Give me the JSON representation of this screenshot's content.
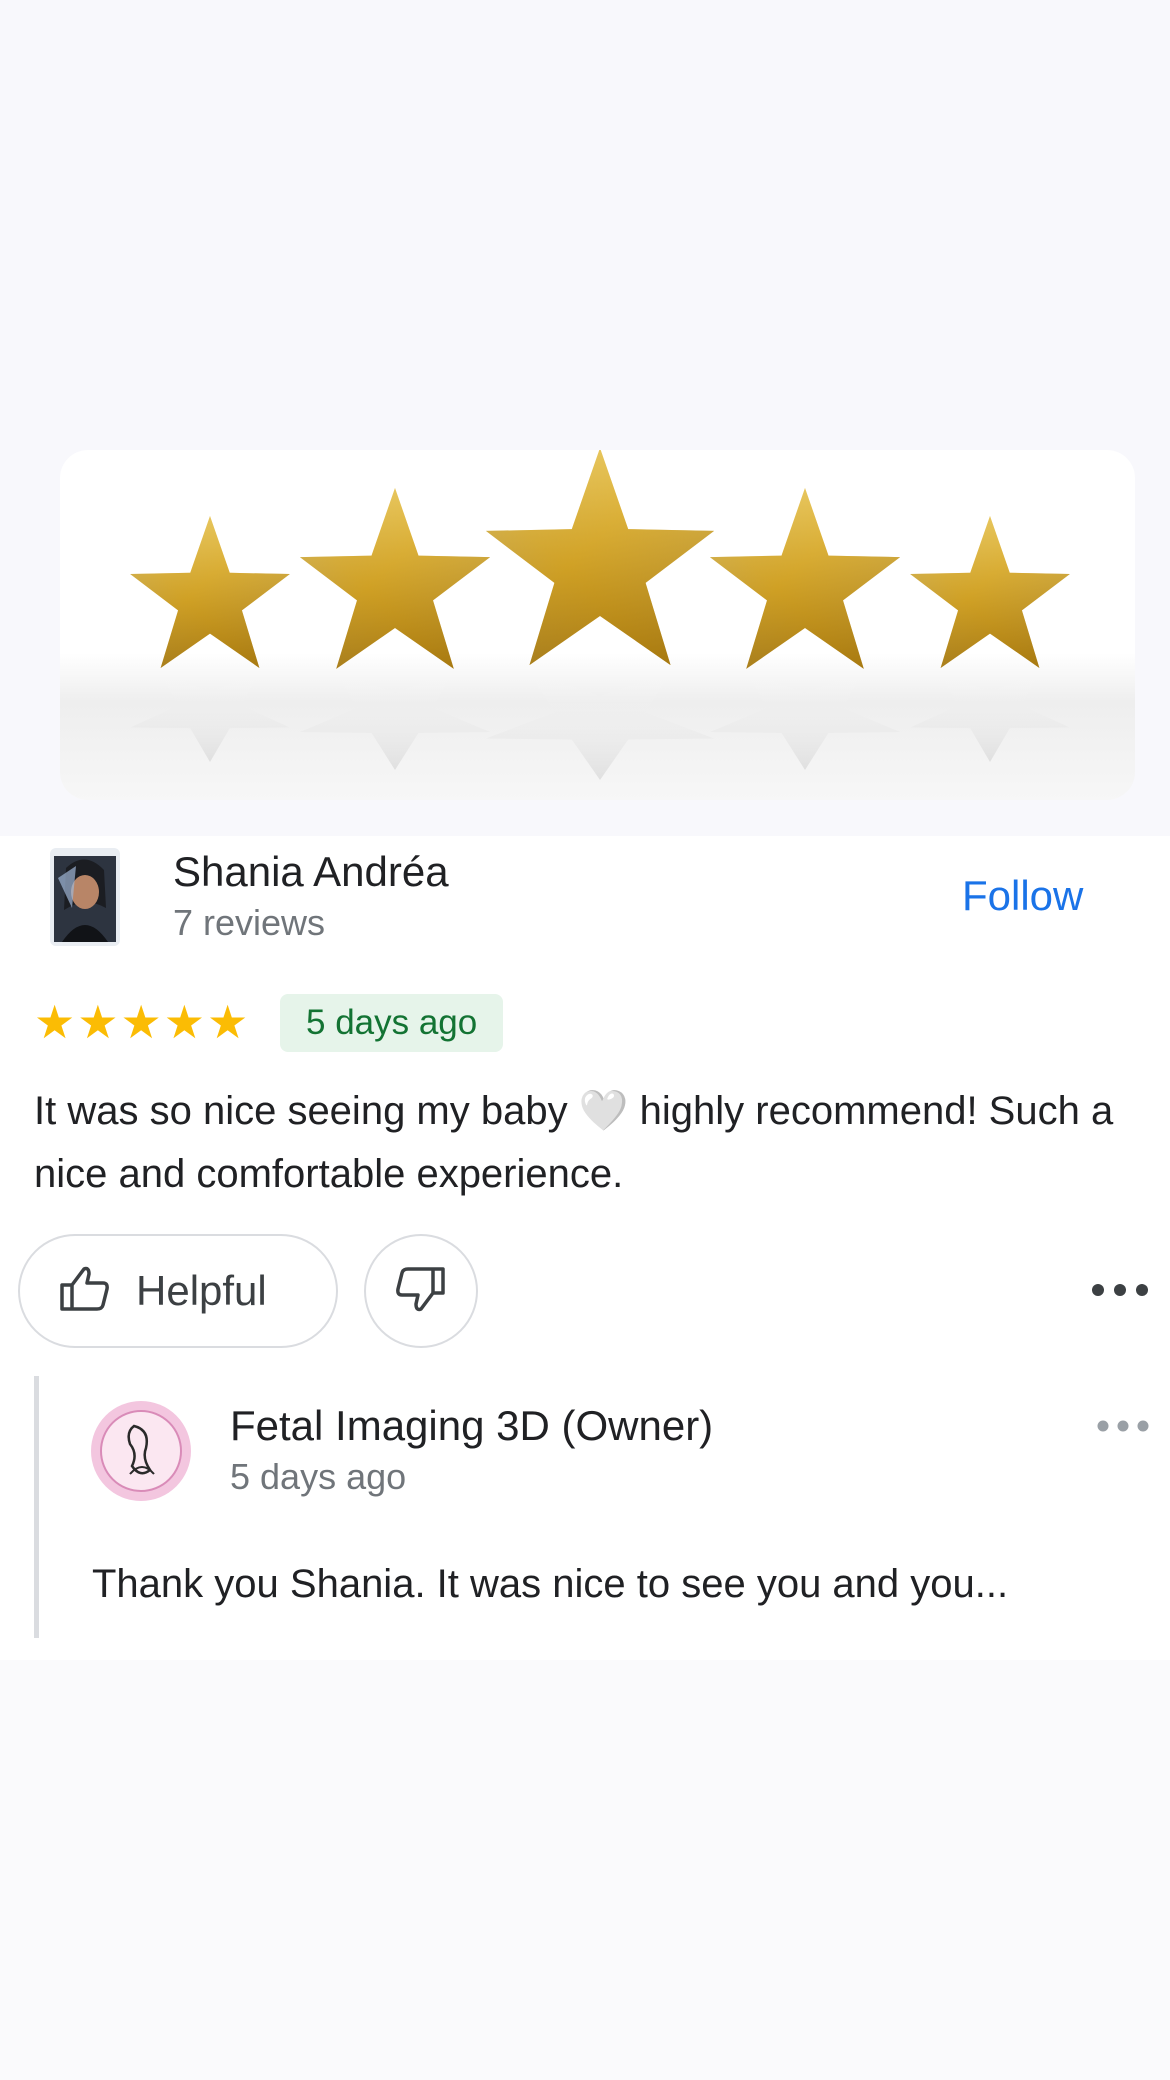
{
  "hero": {
    "image": "five-gold-stars",
    "star_count": 5
  },
  "reviewer": {
    "name": "Shania Andréa",
    "review_count": "7 reviews",
    "follow_label": "Follow"
  },
  "review": {
    "rating": 5,
    "stars": [
      "★",
      "★",
      "★",
      "★",
      "★"
    ],
    "date": "5 days ago",
    "text": "It was so nice seeing my baby 🤍 highly recommend! Such a nice and comfortable experience.",
    "helpful_label": "Helpful"
  },
  "owner_reply": {
    "name": "Fetal Imaging 3D (Owner)",
    "date": "5 days ago",
    "text": "Thank you Shania. It was nice to see you and you..."
  },
  "colors": {
    "accent": "#1a73e8",
    "star": "#fbbc04",
    "badge_bg": "#e6f4ea",
    "badge_text": "#137333"
  }
}
